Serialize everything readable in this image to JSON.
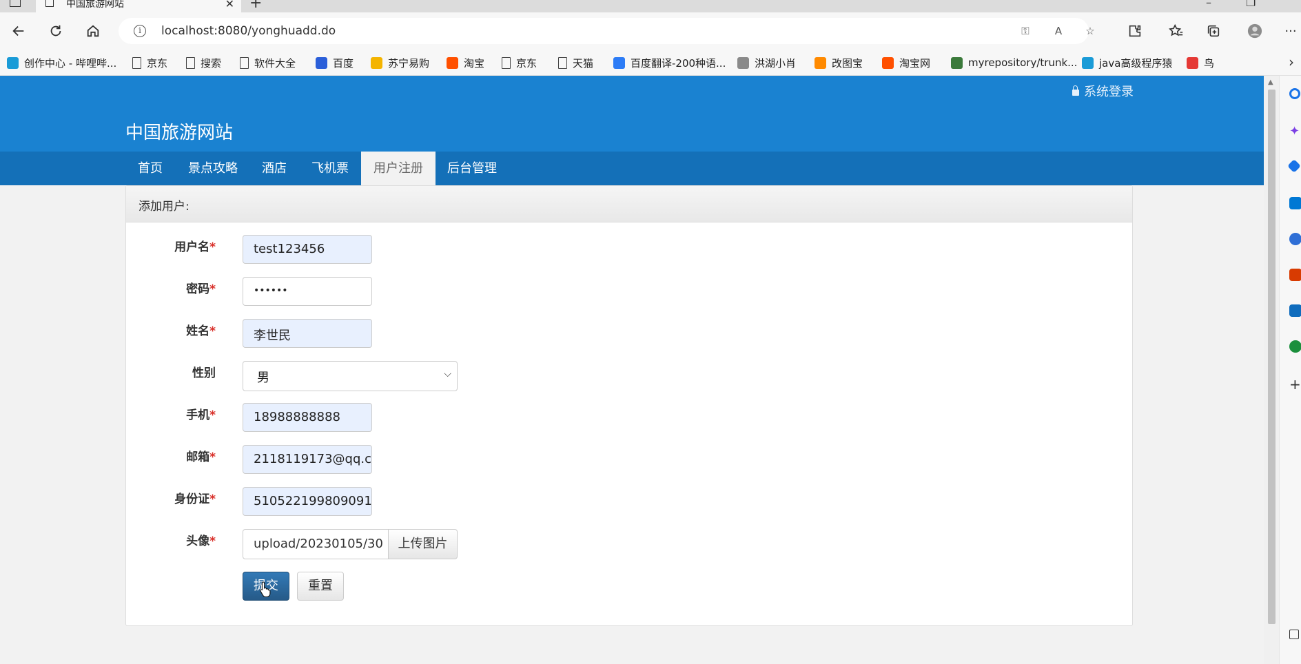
{
  "browser": {
    "tab_title": "中国旅游网站",
    "url": "localhost:8080/yonghuadd.do",
    "bookmarks": [
      {
        "label": "创作中心 - 哔哩哔...",
        "color": "#1a9bd7"
      },
      {
        "label": "京东",
        "color": ""
      },
      {
        "label": "搜索",
        "color": ""
      },
      {
        "label": "软件大全",
        "color": ""
      },
      {
        "label": "百度",
        "color": "#2b5fd9"
      },
      {
        "label": "苏宁易购",
        "color": "#f4b400"
      },
      {
        "label": "淘宝",
        "color": "#ff5000"
      },
      {
        "label": "京东",
        "color": ""
      },
      {
        "label": "天猫",
        "color": ""
      },
      {
        "label": "百度翻译-200种语...",
        "color": "#2d7cf6"
      },
      {
        "label": "洪湖小肖",
        "color": "#8a8a8a"
      },
      {
        "label": "改图宝",
        "color": "#ff8a00"
      },
      {
        "label": "淘宝网",
        "color": "#ff5000"
      },
      {
        "label": "myrepository/trunk...",
        "color": "#3b7a3b"
      },
      {
        "label": "java高级程序猿",
        "color": "#1a9bd7"
      },
      {
        "label": "鸟",
        "color": "#e53935"
      }
    ]
  },
  "site": {
    "title": "中国旅游网站",
    "login_label": "系统登录",
    "nav": [
      "首页",
      "景点攻略",
      "酒店",
      "飞机票",
      "用户注册",
      "后台管理"
    ],
    "active_nav": "用户注册"
  },
  "form": {
    "heading": "添加用户:",
    "fields": {
      "username": {
        "label": "用户名",
        "required": "*",
        "value": "test123456"
      },
      "password": {
        "label": "密码",
        "required": "*",
        "value": "••••••"
      },
      "name": {
        "label": "姓名",
        "required": "*",
        "value": "李世民"
      },
      "gender": {
        "label": "性别",
        "value": "男"
      },
      "phone": {
        "label": "手机",
        "required": "*",
        "value": "18988888888"
      },
      "email": {
        "label": "邮箱",
        "required": "*",
        "value": "2118119173@qq.c"
      },
      "idcard": {
        "label": "身份证",
        "required": "*",
        "value": "510522199809091"
      },
      "avatar": {
        "label": "头像",
        "required": "*",
        "value": "upload/20230105/30"
      }
    },
    "upload_label": "上传图片",
    "submit_label": "提交",
    "reset_label": "重置"
  }
}
